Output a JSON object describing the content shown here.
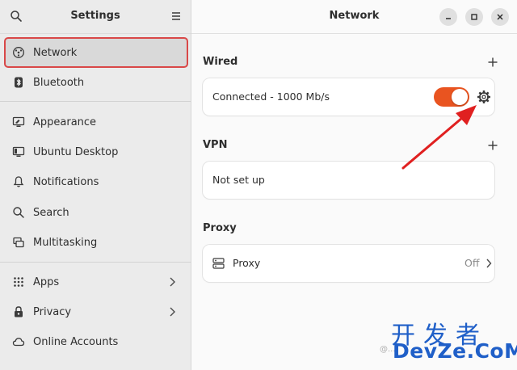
{
  "sidebar": {
    "title": "Settings",
    "search_icon": "search-icon",
    "menu_icon": "hamburger-menu-icon",
    "items": [
      {
        "label": "Network",
        "icon": "network-icon",
        "selected": true
      },
      {
        "label": "Bluetooth",
        "icon": "bluetooth-icon"
      },
      {
        "label": "Appearance",
        "icon": "appearance-icon"
      },
      {
        "label": "Ubuntu Desktop",
        "icon": "ubuntu-desktop-icon"
      },
      {
        "label": "Notifications",
        "icon": "bell-icon"
      },
      {
        "label": "Search",
        "icon": "search-icon"
      },
      {
        "label": "Multitasking",
        "icon": "multitasking-icon"
      },
      {
        "label": "Apps",
        "icon": "apps-grid-icon",
        "has_submenu": true
      },
      {
        "label": "Privacy",
        "icon": "lock-icon",
        "has_submenu": true
      },
      {
        "label": "Online Accounts",
        "icon": "cloud-icon"
      }
    ]
  },
  "main": {
    "title": "Network",
    "window_controls": [
      "minimize-icon",
      "maximize-icon",
      "close-icon"
    ],
    "wired": {
      "title": "Wired",
      "connection_label": "Connected - 1000 Mb/s",
      "toggle_on": true
    },
    "vpn": {
      "title": "VPN",
      "status": "Not set up"
    },
    "proxy": {
      "title": "Proxy",
      "label": "Proxy",
      "status": "Off"
    }
  },
  "watermark": {
    "cn": "开发者",
    "en": "DevZe.CoM",
    "small": "@..."
  },
  "colors": {
    "accent": "#e95420",
    "annotation_red": "#e02020",
    "selection_outline": "#d94848",
    "watermark_blue": "#1f5fc8"
  }
}
